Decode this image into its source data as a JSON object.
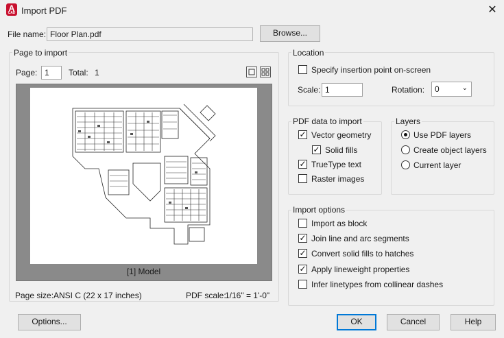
{
  "window": {
    "title": "Import PDF",
    "icon_letter": "A",
    "icon_sub": "CAD"
  },
  "file": {
    "label": "File name:",
    "value": "Floor Plan.pdf",
    "browse": "Browse..."
  },
  "page_import": {
    "title": "Page to import",
    "page_label": "Page:",
    "page_value": "1",
    "total_label": "Total:",
    "total_value": "1",
    "preview_caption": "[1] Model",
    "page_size_label": "Page size:",
    "page_size_value": "ANSI C (22 x 17 inches)",
    "pdf_scale_label": "PDF scale:",
    "pdf_scale_value": "1/16\" = 1'-0\""
  },
  "location": {
    "title": "Location",
    "specify_label": "Specify insertion point on-screen",
    "specify_checked": false,
    "scale_label": "Scale:",
    "scale_value": "1",
    "rotation_label": "Rotation:",
    "rotation_value": "0"
  },
  "pdf_data": {
    "title": "PDF data to import",
    "items": [
      {
        "label": "Vector geometry",
        "checked": true
      },
      {
        "label": "Solid fills",
        "checked": true
      },
      {
        "label": "TrueType text",
        "checked": true
      },
      {
        "label": "Raster images",
        "checked": false
      }
    ]
  },
  "layers": {
    "title": "Layers",
    "options": [
      {
        "label": "Use PDF layers",
        "selected": true
      },
      {
        "label": "Create object layers",
        "selected": false
      },
      {
        "label": "Current layer",
        "selected": false
      }
    ]
  },
  "import_options": {
    "title": "Import options",
    "items": [
      {
        "label": "Import as block",
        "checked": false
      },
      {
        "label": "Join line and arc segments",
        "checked": true
      },
      {
        "label": "Convert solid fills to hatches",
        "checked": true
      },
      {
        "label": "Apply lineweight properties",
        "checked": true
      },
      {
        "label": "Infer linetypes from collinear dashes",
        "checked": false
      }
    ]
  },
  "buttons": {
    "options": "Options...",
    "ok": "OK",
    "cancel": "Cancel",
    "help": "Help"
  },
  "icons": {
    "close": "close-icon",
    "check": "check-icon",
    "chevron": "chevron-down-icon"
  }
}
